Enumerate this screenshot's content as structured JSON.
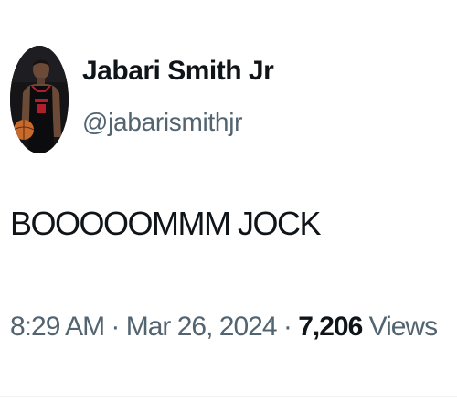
{
  "author": {
    "display_name": "Jabari Smith Jr",
    "handle": "@jabarismithjr",
    "avatar_icon": "profile-photo-basketball-player"
  },
  "tweet": {
    "text": "BOOOOOMMM JOCK"
  },
  "meta": {
    "time": "8:29 AM",
    "separator1": " · ",
    "date": "Mar 26, 2024",
    "separator2": " · ",
    "views_count": "7,206",
    "views_label": " Views"
  },
  "colors": {
    "primary_text": "#0f1419",
    "secondary_text": "#536471",
    "divider": "#eff3f4"
  }
}
